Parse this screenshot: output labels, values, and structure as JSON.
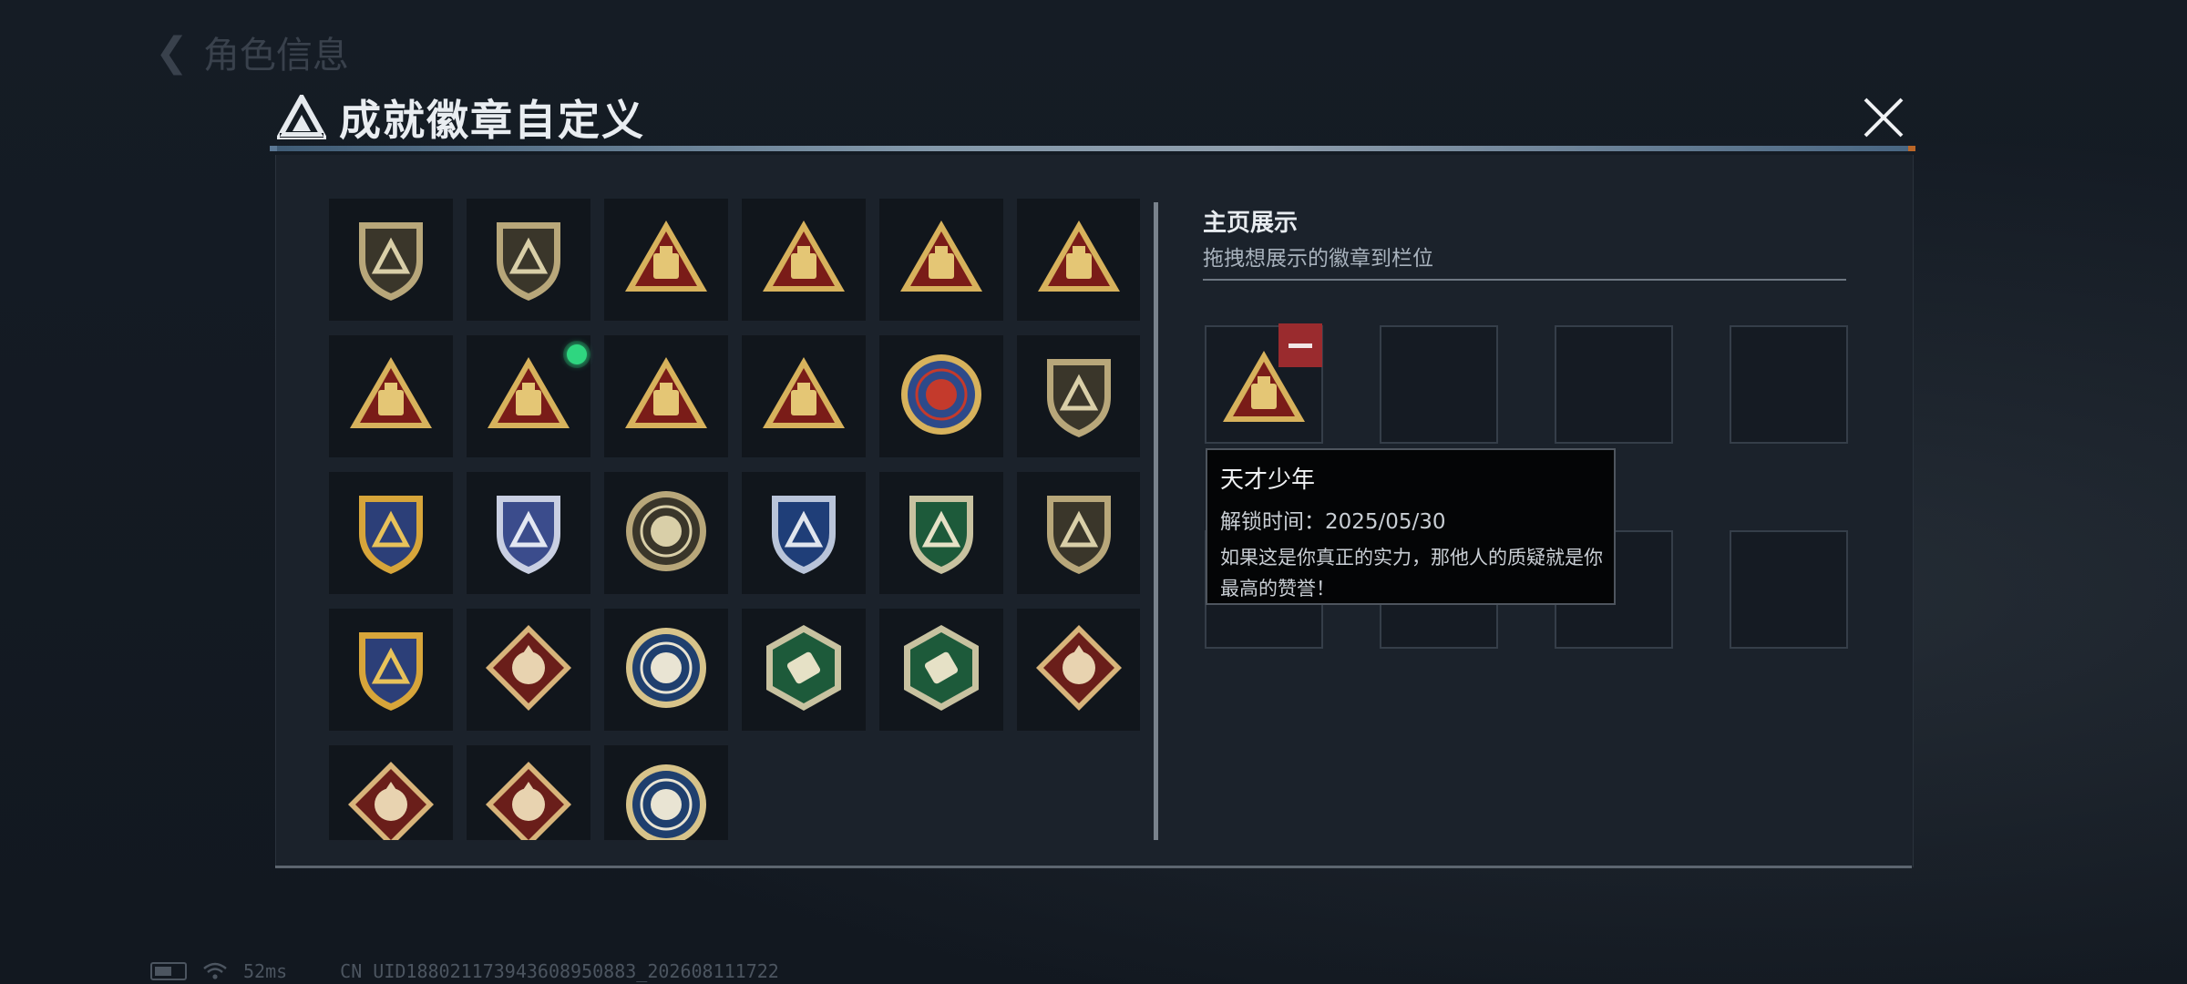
{
  "background": {
    "back_label": "角色信息",
    "status": {
      "ping": "52ms",
      "uid": "CN UID1880211739436089508​83_202608111722"
    }
  },
  "modal": {
    "title": "成就徽章自定义",
    "close_icon": "close-icon"
  },
  "badges": [
    {
      "icon": "shield-logo-badge",
      "theme": "olive"
    },
    {
      "icon": "helicopter-badge",
      "theme": "olive"
    },
    {
      "icon": "triangle-57-badge",
      "theme": "red-gold"
    },
    {
      "icon": "triangle-58-badge",
      "theme": "red-gold"
    },
    {
      "icon": "triangle-59-winged-badge",
      "theme": "red-gold"
    },
    {
      "icon": "triangle-boat-badge",
      "theme": "red-gold"
    },
    {
      "icon": "triangle-1-badge",
      "theme": "red-gold"
    },
    {
      "icon": "triangle-robot-badge",
      "theme": "red-gold",
      "new": true
    },
    {
      "icon": "triangle-hands-badge",
      "theme": "red-gold"
    },
    {
      "icon": "triangle-soldiers-badge",
      "theme": "red-gold"
    },
    {
      "icon": "star-medal-badge",
      "theme": "star"
    },
    {
      "icon": "shield-emblem-badge",
      "theme": "olive"
    },
    {
      "icon": "gold-shield-stars-badge",
      "theme": "gold-blue"
    },
    {
      "icon": "silver-shield-stars-badge",
      "theme": "silver-blue"
    },
    {
      "icon": "skull-circle-badge",
      "theme": "olive"
    },
    {
      "icon": "rifle-shield-blue-badge",
      "theme": "blue-green"
    },
    {
      "icon": "rifle-shield-green-badge",
      "theme": "green"
    },
    {
      "icon": "crosshair-shield-badge",
      "theme": "olive"
    },
    {
      "icon": "crossed-rifles-badge",
      "theme": "gold-blue"
    },
    {
      "icon": "wolf-diamond-badge",
      "theme": "red"
    },
    {
      "icon": "eagle-circle-badge",
      "theme": "blue"
    },
    {
      "icon": "eagle-hexagon-badge",
      "theme": "green"
    },
    {
      "icon": "hammer-hexagon-badge",
      "theme": "green"
    },
    {
      "icon": "dragon-diamond-badge",
      "theme": "red"
    },
    {
      "icon": "dragon-diamond-badge",
      "theme": "red"
    },
    {
      "icon": "runner-diamond-badge",
      "theme": "red"
    },
    {
      "icon": "wolf-circle-badge",
      "theme": "blue"
    }
  ],
  "showcase": {
    "title": "主页展示",
    "subtitle": "拖拽想展示的徽章到栏位",
    "slots": [
      {
        "badge": "triangle-robot-badge"
      },
      {
        "badge": null
      },
      {
        "badge": null
      },
      {
        "badge": null
      },
      {
        "badge": null
      },
      {
        "badge": null
      },
      {
        "badge": null
      },
      {
        "badge": null
      }
    ]
  },
  "tooltip": {
    "name": "天才少年",
    "unlock_time": "解锁时间：2025/05/30",
    "description": "如果这是你真正的实力，那他人的质疑就是你最高的赞誉！"
  }
}
